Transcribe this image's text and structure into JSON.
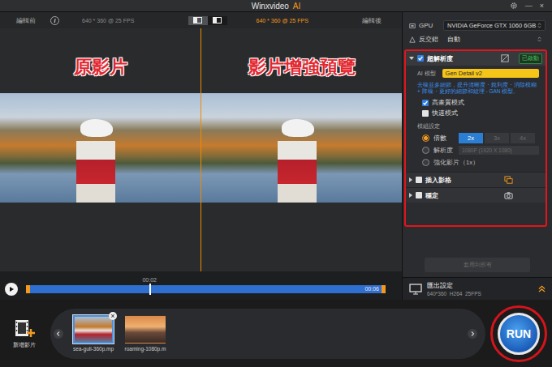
{
  "window": {
    "title": "Winxvideo",
    "title_accent": "AI",
    "controls": [
      "—",
      "×"
    ]
  },
  "preview": {
    "before_label": "編輯前",
    "info_icon": "i",
    "before_info": "640 * 360 @ 25 FPS",
    "after_info": "640 * 360 @ 25 FPS",
    "after_label": "編輯後",
    "view_modes": [
      {
        "selected": true
      },
      {
        "selected": false
      }
    ]
  },
  "annotations": [
    "原影片",
    "影片增強預覽"
  ],
  "timeline": {
    "current": "00:02",
    "end": "00:06",
    "level": 0.34
  },
  "settings": {
    "gpu_label": "GPU",
    "gpu_value": "NVIDIA GeForce GTX 1060 6GB",
    "deinterlace_label": "反交錯",
    "deinterlace_value": "自動"
  },
  "super_resolution": {
    "title": "超解析度",
    "checked": true,
    "expanded": true,
    "badge": "已啟動",
    "model_label": "AI 模型",
    "model": "Gen Detail v2",
    "description": "去噪並多細節，提升清晰度・銳利度・消除模糊 + 降噪・更好的細節和紋理 - GAN 模型。",
    "modes": [
      {
        "label": "高畫質模式",
        "checked": true
      },
      {
        "label": "快速模式",
        "checked": false
      }
    ],
    "module_label": "模組設定",
    "options": [
      {
        "kind": "scale",
        "label": "倍數",
        "selected": true,
        "choices": [
          {
            "label": "2x",
            "selected": true
          },
          {
            "label": "3x",
            "selected": false
          },
          {
            "label": "4x",
            "selected": false
          }
        ]
      },
      {
        "kind": "resolution",
        "label": "解析度",
        "selected": false,
        "value": "1080P (1920 X 1080)"
      },
      {
        "kind": "plain",
        "label": "強化影片（1x）",
        "selected": false
      }
    ]
  },
  "features": [
    {
      "title": "插入影格",
      "checked": false,
      "expanded": false
    },
    {
      "title": "穩定",
      "checked": false,
      "expanded": false
    }
  ],
  "apply_all": {
    "label": "套用到所有",
    "disabled": true
  },
  "output": {
    "title": "匯出設定",
    "info": "640*360  H264  25FPS"
  },
  "bottom": {
    "add_label": "新增影片",
    "close_icon": "×",
    "clips": [
      {
        "name": "sea-gull-360p.mp",
        "selected": true
      },
      {
        "name": "roaming-1080p.m",
        "selected": false
      }
    ],
    "run": "RUN"
  }
}
